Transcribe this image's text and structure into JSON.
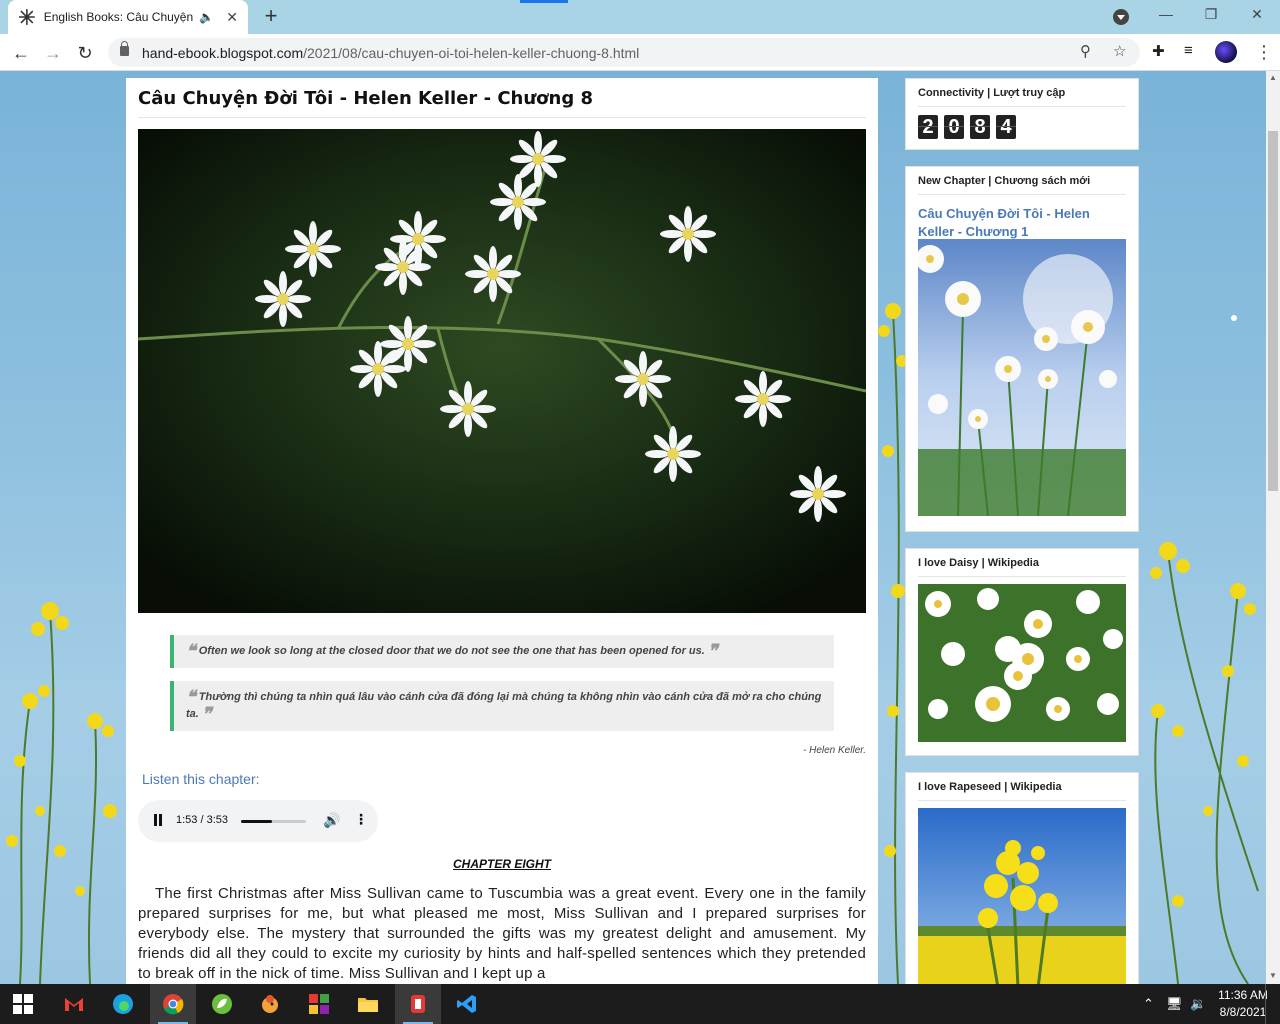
{
  "browser": {
    "tab_title": "English Books: Câu Chuyện Đ",
    "tab_audio_icon": "speaker-icon",
    "new_tab_label": "+",
    "url_host": "hand-ebook.blogspot.com",
    "url_path": "/2021/08/cau-chuyen-oi-toi-helen-keller-chuong-8.html"
  },
  "post": {
    "title": "Câu Chuyện Đời Tôi - Helen Keller - Chương 8",
    "quote_en": "Often we look so long at the closed door that we do not see the one that has been opened for us.",
    "quote_vi": "Thường thì chúng ta nhìn quá lâu vào cánh cửa đã đóng lại mà chúng ta không nhìn vào cánh cửa đã mở ra cho chúng ta.",
    "quote_author": "-  Helen Keller.",
    "listen_label": "Listen this chapter:",
    "audio_time": "1:53 / 3:53",
    "audio_progress": 0.48,
    "chapter_heading": "CHAPTER EIGHT",
    "body": "   The first Christmas after Miss Sullivan came to Tuscumbia was a great event. Every one in the family prepared surprises for me, but what pleased me most, Miss Sullivan and I prepared surprises for everybody else. The mystery that surrounded the gifts was my greatest delight and amusement. My friends did all they could to excite my curiosity by hints and half-spelled sentences which they pretended to break off in the nick of time. Miss Sullivan and I kept up a"
  },
  "sidebar": {
    "counter_title": "Connectivity | Lượt truy cập",
    "counter_digits": [
      "2",
      "0",
      "8",
      "4"
    ],
    "new_chapter_title": "New Chapter | Chương sách mới",
    "new_chapter_link": "Câu Chuyện Đời Tôi - Helen Keller - Chương 1",
    "daisy_title": "I love Daisy | Wikipedia",
    "rapeseed_title": "I love Rapeseed | Wikipedia"
  },
  "taskbar": {
    "time": "11:36 AM",
    "date": "8/8/2021"
  },
  "colors": {
    "tabbar": "#a8d4e6",
    "link": "#4a7ab5",
    "quote_border": "#3cb371"
  }
}
